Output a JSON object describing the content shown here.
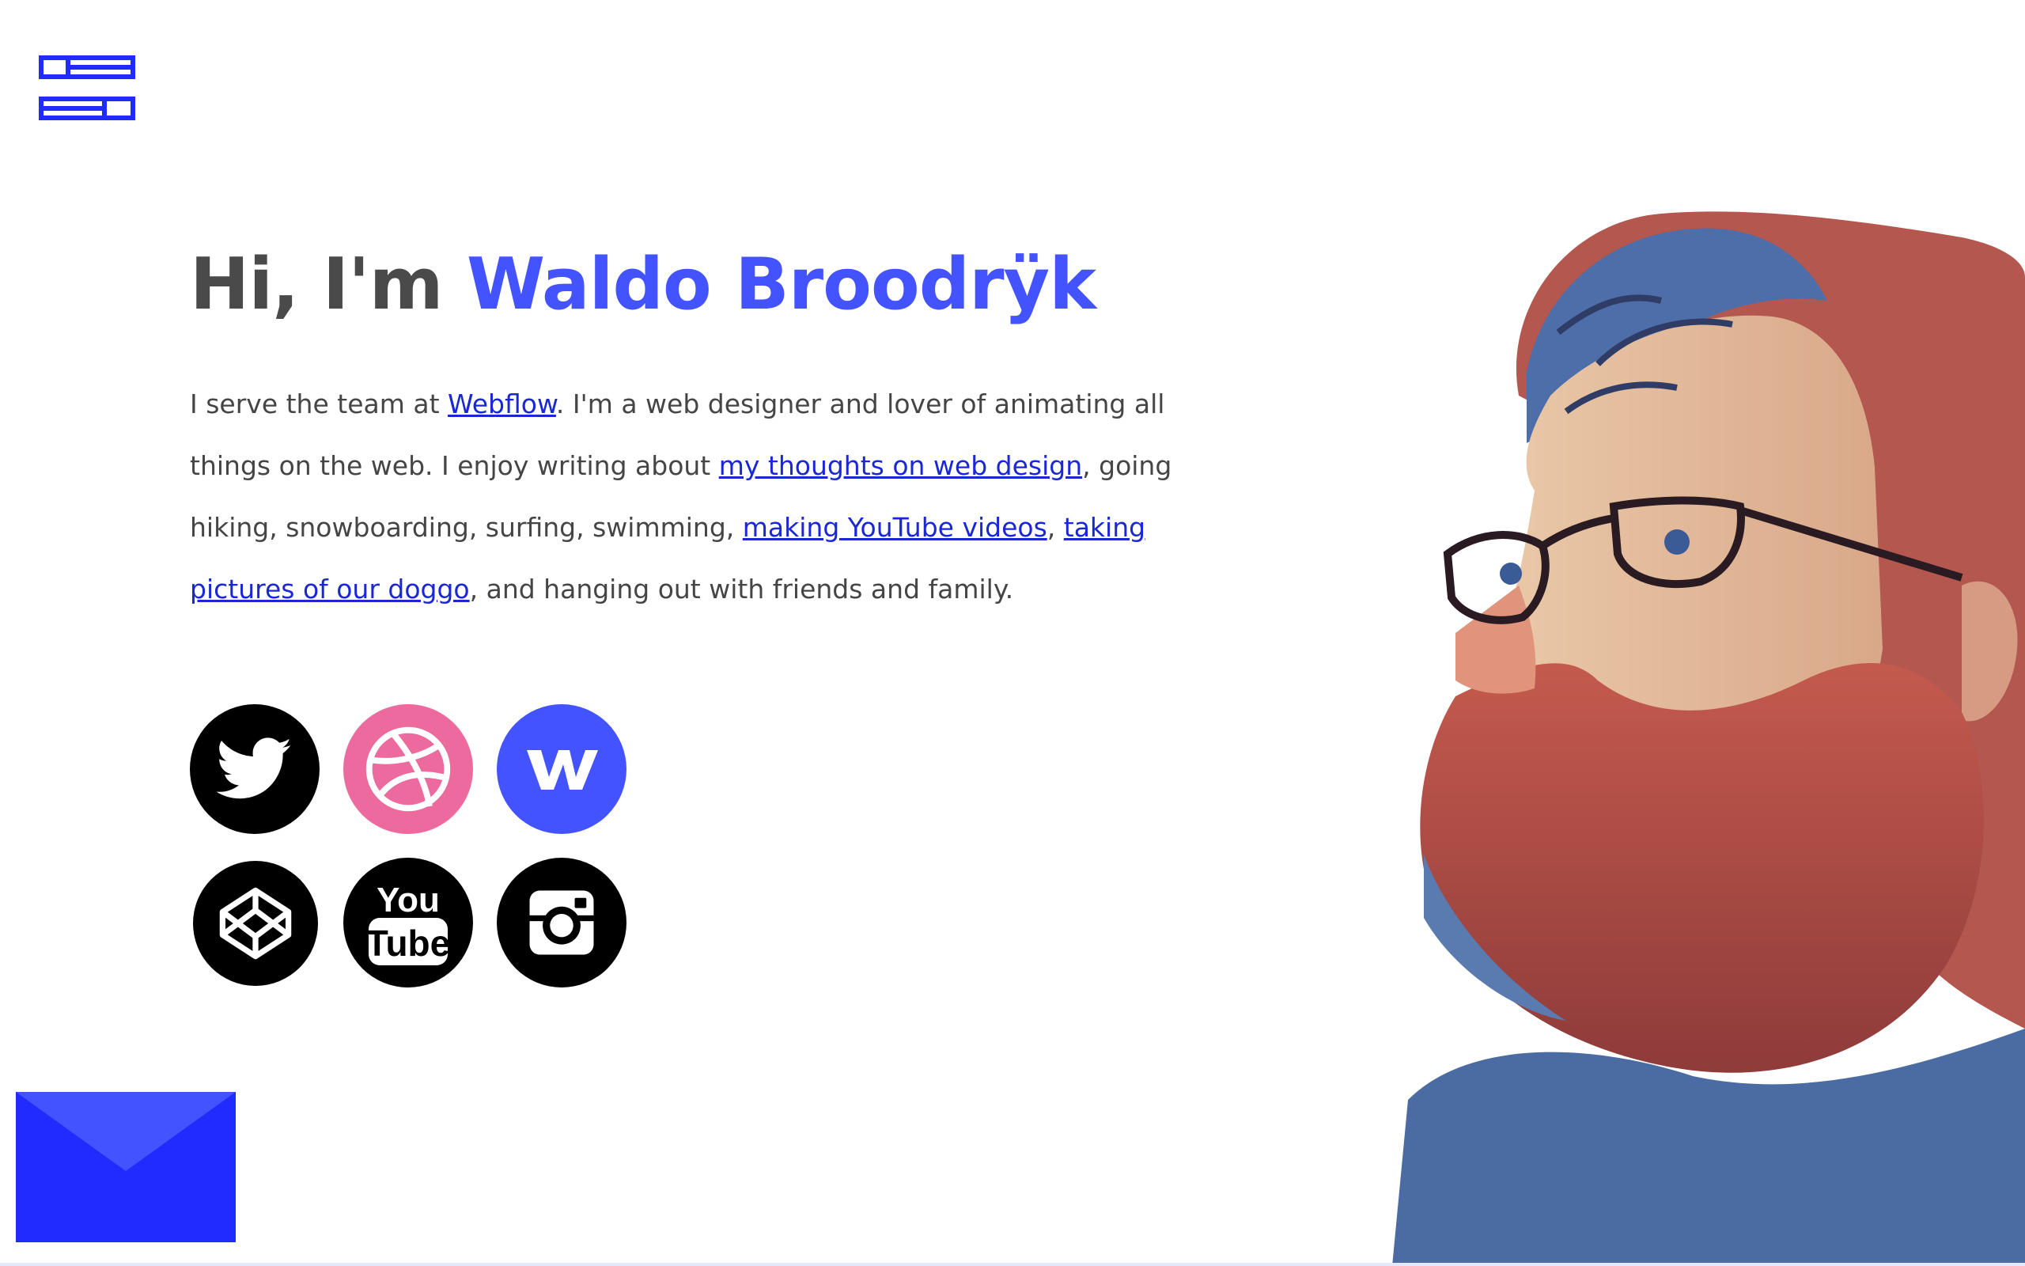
{
  "menu": {
    "icon": "menu-logo-icon"
  },
  "hero": {
    "greeting": "Hi, I'm ",
    "name": "Waldo Broodrÿk"
  },
  "bio": {
    "t1": "I serve the team at ",
    "link_webflow": "Webflow",
    "t2": ". I'm a web designer and lover of animating all things on the web. I enjoy writing about ",
    "link_thoughts": "my thoughts on web design",
    "t3": ", going hiking, snowboarding, surfing, swimming, ",
    "link_youtube": "making YouTube videos",
    "t4": ", ",
    "link_doggo": "taking pictures of our doggo",
    "t5": ", and hanging out with friends and family."
  },
  "socials": [
    {
      "icon": "twitter-icon"
    },
    {
      "icon": "dribbble-icon"
    },
    {
      "icon": "webflow-icon"
    },
    {
      "icon": "codepen-icon"
    },
    {
      "icon": "youtube-icon",
      "glyph_top": "You",
      "glyph_bottom": "Tube"
    },
    {
      "icon": "instagram-icon"
    }
  ],
  "colors": {
    "accent": "#4353ff",
    "link": "#1a27d6",
    "text": "#454545",
    "dribbble": "#ec6a9d",
    "mail": "#1f2bff"
  },
  "contact": {
    "icon": "mail-icon"
  }
}
